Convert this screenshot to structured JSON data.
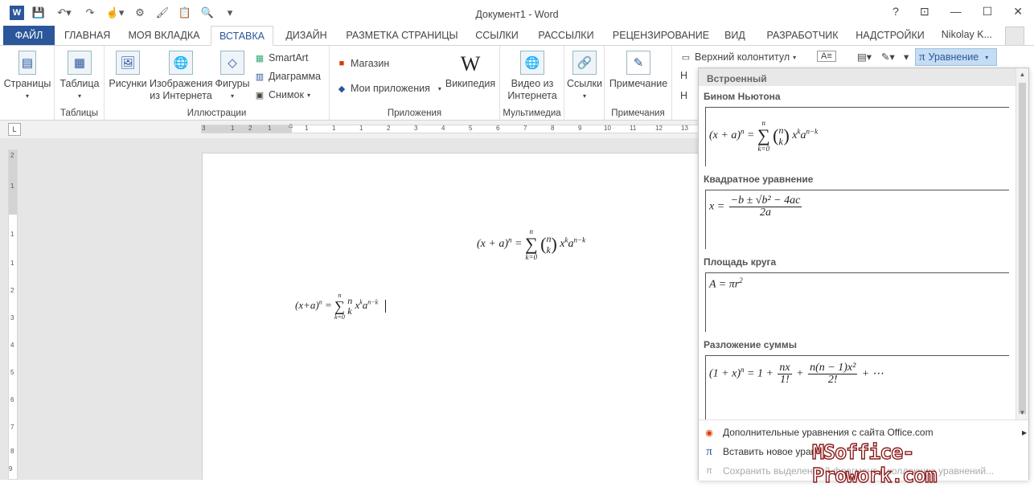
{
  "window": {
    "title": "Документ1 - Word",
    "help": "?",
    "ribbon_opts": "⊡",
    "minimize": "—",
    "maximize": "☐",
    "close": "✕"
  },
  "qat": {
    "logo": "W",
    "save_icon": "💾",
    "undo": "↶▾",
    "redo": "↷",
    "touch": "☝▾",
    "misc1": "⚙",
    "brush": "🖌",
    "paste": "📋",
    "preview": "🔍",
    "more": "▾"
  },
  "tabs": [
    "ФАЙЛ",
    "ГЛАВНАЯ",
    "МОЯ ВКЛАДКА",
    "ВСТАВКА",
    "ДИЗАЙН",
    "РАЗМЕТКА СТРАНИЦЫ",
    "ССЫЛКИ",
    "РАССЫЛКИ",
    "РЕЦЕНЗИРОВАНИЕ",
    "ВИД",
    "РАЗРАБОТЧИК",
    "НАДСТРОЙКИ"
  ],
  "active_tab": "ВСТАВКА",
  "user": "Nikolay K...",
  "ribbon": {
    "pages": "Страницы",
    "table": "Таблица",
    "tables_group": "Таблицы",
    "pictures": "Рисунки",
    "online_images_1": "Изображения",
    "online_images_2": "из Интернета",
    "shapes": "Фигуры",
    "smartart": "SmartArt",
    "chart": "Диаграмма",
    "screenshot": "Снимок",
    "illustrations_group": "Иллюстрации",
    "store": "Магазин",
    "my_apps": "Мои приложения",
    "wikipedia": "Википедия",
    "apps_group": "Приложения",
    "video_1": "Видео из",
    "video_2": "Интернета",
    "media_group": "Мультимедиа",
    "links": "Ссылки",
    "comment": "Примечание",
    "comments_group": "Примечания",
    "header": "Верхний колонтитул",
    "equation": "Уравнение",
    "letter_n": "Н"
  },
  "ruler": [
    "3",
    "1",
    "2",
    "1",
    "1",
    "1",
    "1",
    "2",
    "3",
    "4",
    "5",
    "6",
    "7",
    "8",
    "9",
    "10",
    "11",
    "12",
    "13"
  ],
  "vruler": [
    "2",
    "1",
    "1",
    "1",
    "2",
    "3",
    "4",
    "5",
    "6",
    "7",
    "8",
    "9",
    "10"
  ],
  "document": {
    "eq1": {
      "lhs": "(x + a)",
      "n": "n",
      "eq": "=",
      "sum_top": "n",
      "sum_bot": "k=0",
      "binom_top": "n",
      "binom_bot": "k",
      "x": "x",
      "k": "k",
      "a": "a",
      "nk": "n−k"
    },
    "eq2": {
      "lhs": "(x+a)",
      "n": "n",
      "eq": "=",
      "sum_top": "n",
      "sum_bot": "k=0",
      "binom_top": "n",
      "binom_bot": "k",
      "x": "x",
      "k": "k",
      "a": "a",
      "nk": "n−k"
    }
  },
  "panel": {
    "header": "Встроенный",
    "items": [
      {
        "title": "Бином Ньютона"
      },
      {
        "title": "Квадратное уравнение"
      },
      {
        "title": "Площадь круга"
      },
      {
        "title": "Разложение суммы"
      }
    ],
    "binom": {
      "lhs": "(x + a)",
      "n": "n",
      "eq": "=",
      "sum_top": "n",
      "sum_bot": "k=0",
      "binom_top": "n",
      "binom_bot": "k",
      "x": "x",
      "k": "k",
      "a": "a",
      "nk": "n−k"
    },
    "quadratic": {
      "x": "x =",
      "num": "−b ± √b² − 4ac",
      "den": "2a"
    },
    "circle": {
      "text": "A = πr",
      "sup": "2"
    },
    "expansion": {
      "lhs": "(1 + x)",
      "n": "n",
      "eq": "= 1 +",
      "f1_num": "nx",
      "f1_den": "1!",
      "plus": "+",
      "f2_num": "n(n − 1)x²",
      "f2_den": "2!",
      "tail": "+ ⋯"
    },
    "footer": [
      {
        "label": "Дополнительные уравнения с сайта Office.com",
        "arrow": "▸"
      },
      {
        "label": "Вставить новое урав"
      },
      {
        "label": "Сохранить выделенный фрагмент в коллекцию уравнений..."
      }
    ]
  },
  "watermark": "MSoffice-Prowork.com"
}
